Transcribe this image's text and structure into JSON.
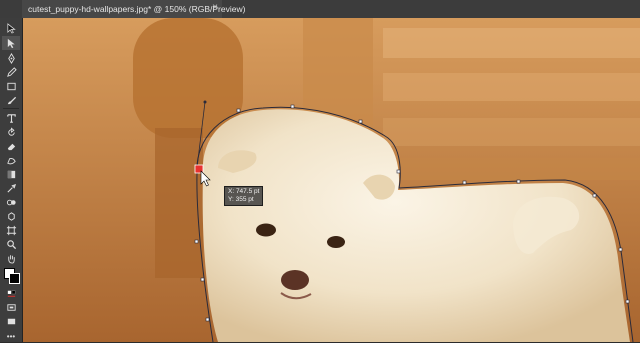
{
  "document_tab": {
    "title": "cutest_puppy-hd-wallpapers.jpg* @ 150% (RGB/Preview)",
    "close_glyph": "×"
  },
  "tools": [
    {
      "name": "move-tool-icon"
    },
    {
      "name": "direct-selection-tool-icon"
    },
    {
      "name": "pen-tool-icon"
    },
    {
      "name": "pencil-tool-icon"
    },
    {
      "name": "rectangle-tool-icon"
    },
    {
      "name": "brush-tool-icon"
    },
    {
      "name": "type-tool-icon"
    },
    {
      "name": "rotate-tool-icon"
    },
    {
      "name": "eraser-tool-icon"
    },
    {
      "name": "blob-brush-tool-icon"
    },
    {
      "name": "gradient-tool-icon"
    },
    {
      "name": "eyedropper-tool-icon"
    },
    {
      "name": "blend-tool-icon"
    },
    {
      "name": "symbol-sprayer-icon"
    },
    {
      "name": "artboard-tool-icon"
    },
    {
      "name": "zoom-tool-icon"
    },
    {
      "name": "hand-tool-icon"
    }
  ],
  "readout": {
    "x": "X: 747.5 pt",
    "y": "Y: 355 pt"
  },
  "colors": {
    "panel": "#3d3d3d",
    "anchor": "#e8322f",
    "path": "#2a2a3a"
  },
  "more_tools_label": "•••"
}
